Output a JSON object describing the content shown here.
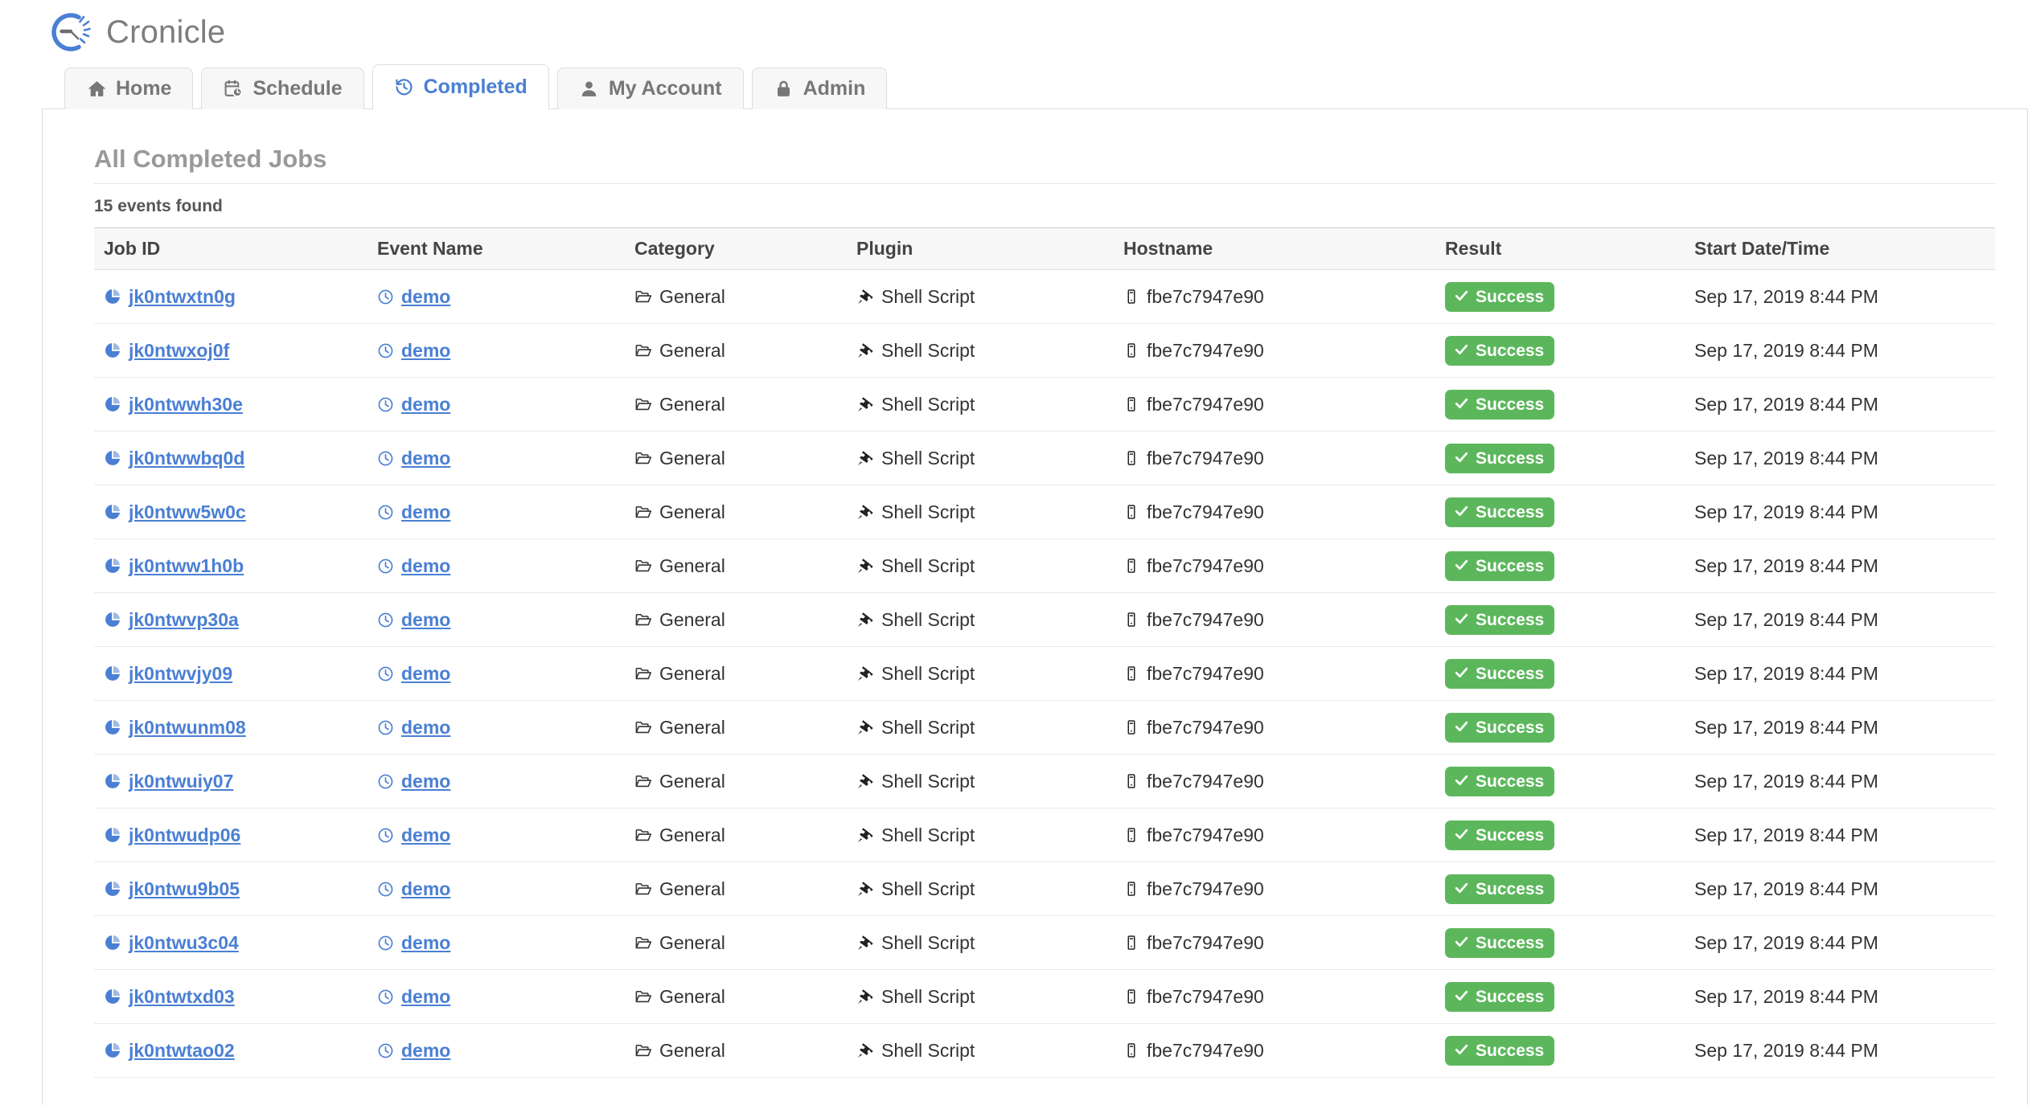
{
  "app": {
    "name": "Cronicle",
    "logo_icon": "cronicle-clock-logo"
  },
  "tabs": [
    {
      "label": "Home",
      "icon": "home-icon",
      "active": false
    },
    {
      "label": "Schedule",
      "icon": "calendar-clock-icon",
      "active": false
    },
    {
      "label": "Completed",
      "icon": "history-icon",
      "active": true
    },
    {
      "label": "My Account",
      "icon": "user-icon",
      "active": false
    },
    {
      "label": "Admin",
      "icon": "lock-icon",
      "active": false
    }
  ],
  "main": {
    "title": "All Completed Jobs",
    "results_text": "15 events found",
    "columns": [
      "Job ID",
      "Event Name",
      "Category",
      "Plugin",
      "Hostname",
      "Result",
      "Start Date/Time"
    ],
    "icons": {
      "job": "pie-chart-icon",
      "event": "clock-icon",
      "category": "folder-open-icon",
      "plugin": "plug-icon",
      "hostname": "server-icon",
      "result": "check-icon"
    },
    "colors": {
      "link": "#4a7fd4",
      "success_badge": "#5cb75c",
      "active_tab_text": "#4a7fd4",
      "title": "#999999"
    },
    "rows": [
      {
        "job_id": "jk0ntwxtn0g",
        "event_name": "demo",
        "category": "General",
        "plugin": "Shell Script",
        "hostname": "fbe7c7947e90",
        "result": "Success",
        "start": "Sep 17, 2019 8:44 PM"
      },
      {
        "job_id": "jk0ntwxoj0f",
        "event_name": "demo",
        "category": "General",
        "plugin": "Shell Script",
        "hostname": "fbe7c7947e90",
        "result": "Success",
        "start": "Sep 17, 2019 8:44 PM"
      },
      {
        "job_id": "jk0ntwwh30e",
        "event_name": "demo",
        "category": "General",
        "plugin": "Shell Script",
        "hostname": "fbe7c7947e90",
        "result": "Success",
        "start": "Sep 17, 2019 8:44 PM"
      },
      {
        "job_id": "jk0ntwwbq0d",
        "event_name": "demo",
        "category": "General",
        "plugin": "Shell Script",
        "hostname": "fbe7c7947e90",
        "result": "Success",
        "start": "Sep 17, 2019 8:44 PM"
      },
      {
        "job_id": "jk0ntww5w0c",
        "event_name": "demo",
        "category": "General",
        "plugin": "Shell Script",
        "hostname": "fbe7c7947e90",
        "result": "Success",
        "start": "Sep 17, 2019 8:44 PM"
      },
      {
        "job_id": "jk0ntww1h0b",
        "event_name": "demo",
        "category": "General",
        "plugin": "Shell Script",
        "hostname": "fbe7c7947e90",
        "result": "Success",
        "start": "Sep 17, 2019 8:44 PM"
      },
      {
        "job_id": "jk0ntwvp30a",
        "event_name": "demo",
        "category": "General",
        "plugin": "Shell Script",
        "hostname": "fbe7c7947e90",
        "result": "Success",
        "start": "Sep 17, 2019 8:44 PM"
      },
      {
        "job_id": "jk0ntwvjy09",
        "event_name": "demo",
        "category": "General",
        "plugin": "Shell Script",
        "hostname": "fbe7c7947e90",
        "result": "Success",
        "start": "Sep 17, 2019 8:44 PM"
      },
      {
        "job_id": "jk0ntwunm08",
        "event_name": "demo",
        "category": "General",
        "plugin": "Shell Script",
        "hostname": "fbe7c7947e90",
        "result": "Success",
        "start": "Sep 17, 2019 8:44 PM"
      },
      {
        "job_id": "jk0ntwuiy07",
        "event_name": "demo",
        "category": "General",
        "plugin": "Shell Script",
        "hostname": "fbe7c7947e90",
        "result": "Success",
        "start": "Sep 17, 2019 8:44 PM"
      },
      {
        "job_id": "jk0ntwudp06",
        "event_name": "demo",
        "category": "General",
        "plugin": "Shell Script",
        "hostname": "fbe7c7947e90",
        "result": "Success",
        "start": "Sep 17, 2019 8:44 PM"
      },
      {
        "job_id": "jk0ntwu9b05",
        "event_name": "demo",
        "category": "General",
        "plugin": "Shell Script",
        "hostname": "fbe7c7947e90",
        "result": "Success",
        "start": "Sep 17, 2019 8:44 PM"
      },
      {
        "job_id": "jk0ntwu3c04",
        "event_name": "demo",
        "category": "General",
        "plugin": "Shell Script",
        "hostname": "fbe7c7947e90",
        "result": "Success",
        "start": "Sep 17, 2019 8:44 PM"
      },
      {
        "job_id": "jk0ntwtxd03",
        "event_name": "demo",
        "category": "General",
        "plugin": "Shell Script",
        "hostname": "fbe7c7947e90",
        "result": "Success",
        "start": "Sep 17, 2019 8:44 PM"
      },
      {
        "job_id": "jk0ntwtao02",
        "event_name": "demo",
        "category": "General",
        "plugin": "Shell Script",
        "hostname": "fbe7c7947e90",
        "result": "Success",
        "start": "Sep 17, 2019 8:44 PM"
      }
    ]
  }
}
